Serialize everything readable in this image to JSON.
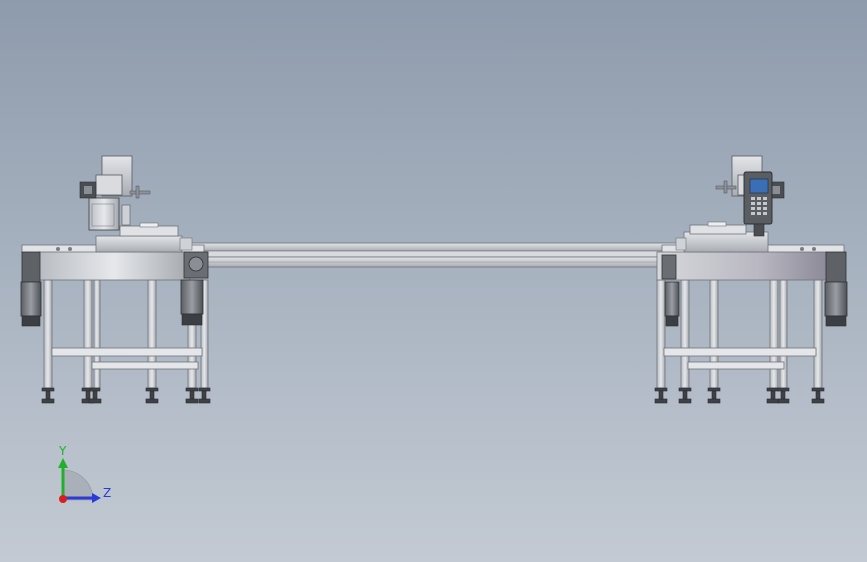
{
  "viewport": {
    "background_top": "#8e9bac",
    "background_bottom": "#c3cad3"
  },
  "triad": {
    "y_label": "Y",
    "z_label": "Z",
    "y_color": "#22b02a",
    "z_color": "#2a3bd6",
    "x_color": "#d81e1e"
  },
  "model": {
    "frame_color": "#b9bcc1",
    "dark_color": "#4a4d52",
    "screen_color": "#3a6fb8"
  }
}
